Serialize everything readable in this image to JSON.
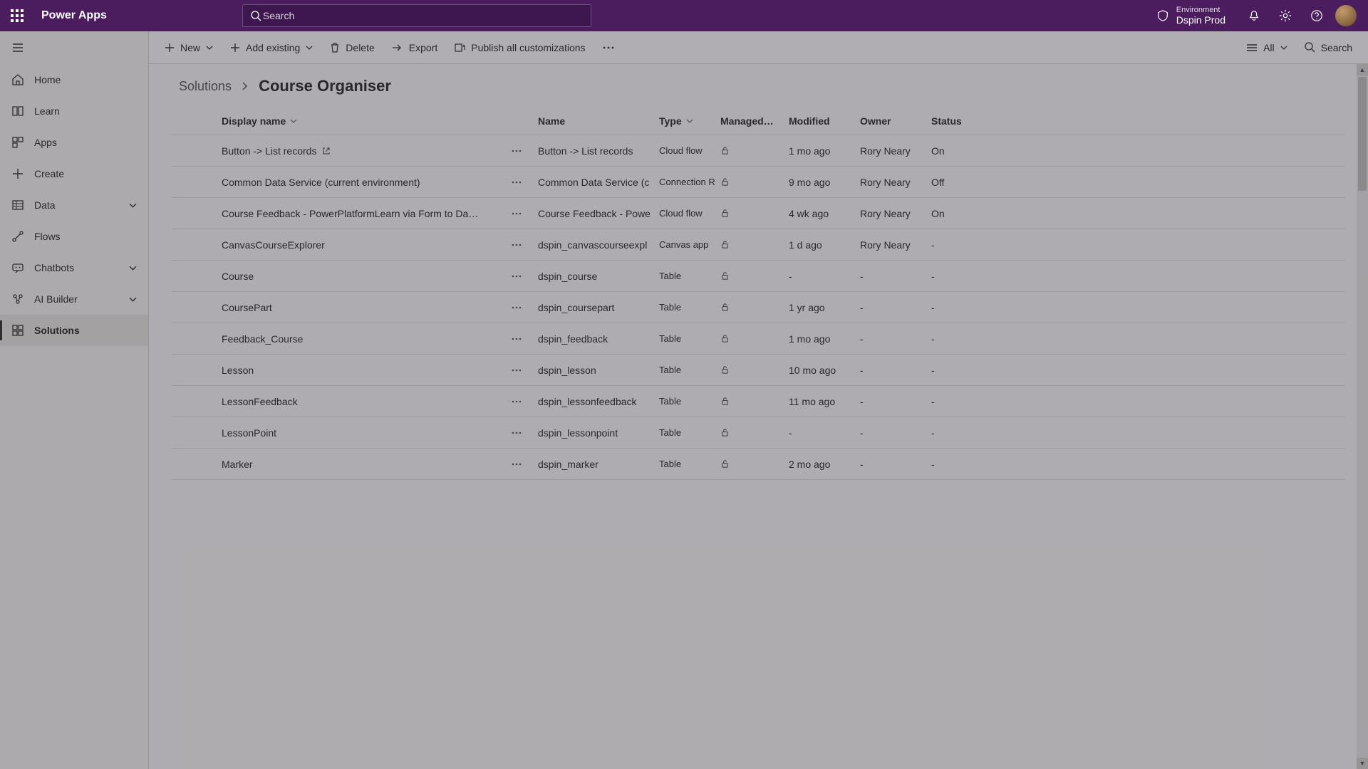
{
  "header": {
    "product": "Power Apps",
    "search_placeholder": "Search",
    "env_label": "Environment",
    "env_name": "Dspin Prod"
  },
  "nav": {
    "items": [
      {
        "label": "Home",
        "icon": "home"
      },
      {
        "label": "Learn",
        "icon": "learn"
      },
      {
        "label": "Apps",
        "icon": "apps"
      },
      {
        "label": "Create",
        "icon": "create"
      },
      {
        "label": "Data",
        "icon": "data",
        "expandable": true
      },
      {
        "label": "Flows",
        "icon": "flows"
      },
      {
        "label": "Chatbots",
        "icon": "chatbots",
        "expandable": true
      },
      {
        "label": "AI Builder",
        "icon": "ai",
        "expandable": true
      },
      {
        "label": "Solutions",
        "icon": "solutions",
        "active": true
      }
    ]
  },
  "commands": {
    "new": "New",
    "add": "Add existing",
    "delete": "Delete",
    "export": "Export",
    "publish": "Publish all customizations",
    "filter": "All",
    "search": "Search"
  },
  "breadcrumb": {
    "parent": "Solutions",
    "current": "Course Organiser"
  },
  "columns": {
    "display": "Display name",
    "name": "Name",
    "type": "Type",
    "managed": "Managed…",
    "modified": "Modified",
    "owner": "Owner",
    "status": "Status"
  },
  "rows": [
    {
      "display": "Button -> List records",
      "openext": true,
      "name": "Button -> List records",
      "type": "Cloud flow",
      "modified": "1 mo ago",
      "owner": "Rory Neary",
      "status": "On"
    },
    {
      "display": "Common Data Service (current environment)",
      "openext": false,
      "name": "Common Data Service (c",
      "type": "Connection Ref",
      "modified": "9 mo ago",
      "owner": "Rory Neary",
      "status": "Off"
    },
    {
      "display": "Course Feedback - PowerPlatformLearn via Form to Da…",
      "openext": false,
      "name": "Course Feedback - Powe",
      "type": "Cloud flow",
      "modified": "4 wk ago",
      "owner": "Rory Neary",
      "status": "On"
    },
    {
      "display": "CanvasCourseExplorer",
      "openext": false,
      "name": "dspin_canvascourseexpl",
      "type": "Canvas app",
      "modified": "1 d ago",
      "owner": "Rory Neary",
      "status": "-"
    },
    {
      "display": "Course",
      "openext": false,
      "name": "dspin_course",
      "type": "Table",
      "modified": "-",
      "owner": "-",
      "status": "-"
    },
    {
      "display": "CoursePart",
      "openext": false,
      "name": "dspin_coursepart",
      "type": "Table",
      "modified": "1 yr ago",
      "owner": "-",
      "status": "-"
    },
    {
      "display": "Feedback_Course",
      "openext": false,
      "name": "dspin_feedback",
      "type": "Table",
      "modified": "1 mo ago",
      "owner": "-",
      "status": "-"
    },
    {
      "display": "Lesson",
      "openext": false,
      "name": "dspin_lesson",
      "type": "Table",
      "modified": "10 mo ago",
      "owner": "-",
      "status": "-"
    },
    {
      "display": "LessonFeedback",
      "openext": false,
      "name": "dspin_lessonfeedback",
      "type": "Table",
      "modified": "11 mo ago",
      "owner": "-",
      "status": "-"
    },
    {
      "display": "LessonPoint",
      "openext": false,
      "name": "dspin_lessonpoint",
      "type": "Table",
      "modified": "-",
      "owner": "-",
      "status": "-"
    },
    {
      "display": "Marker",
      "openext": false,
      "name": "dspin_marker",
      "type": "Table",
      "modified": "2 mo ago",
      "owner": "-",
      "status": "-"
    }
  ]
}
